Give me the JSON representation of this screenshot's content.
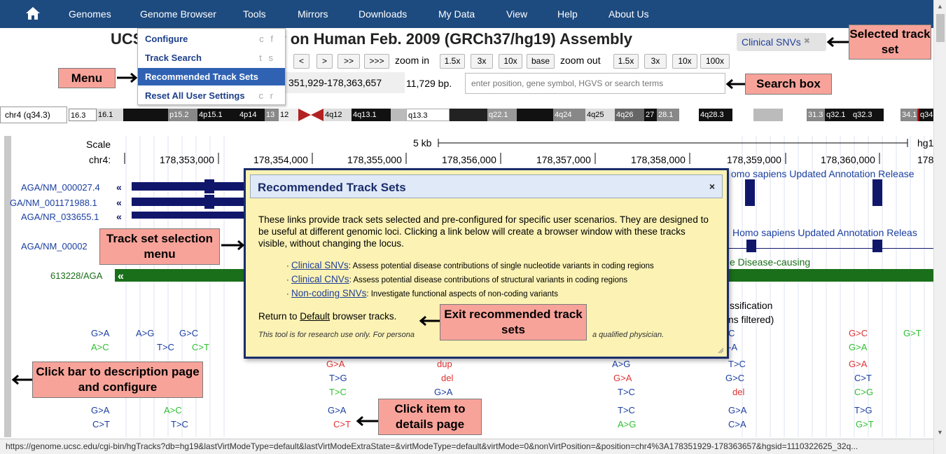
{
  "nav": {
    "items": [
      "Genomes",
      "Genome Browser",
      "Tools",
      "Mirrors",
      "Downloads",
      "My Data",
      "View",
      "Help",
      "About Us"
    ]
  },
  "menu": {
    "items": [
      {
        "label": "Configure",
        "shortcut": "c f"
      },
      {
        "label": "Track Search",
        "shortcut": "t s"
      },
      {
        "label": "Recommended Track Sets",
        "shortcut": ""
      },
      {
        "label": "Reset All User Settings",
        "shortcut": "c r"
      }
    ]
  },
  "title": "UCSC Genome Browser on Human Feb. 2009 (GRCh37/hg19) Assembly",
  "trackset_badge": {
    "label": "Clinical SNVs",
    "close": "✖"
  },
  "controls": {
    "move_buttons": [
      "<",
      ">",
      ">>",
      ">>>"
    ],
    "zoom_in_label": "zoom in",
    "zoom_in_buttons": [
      "1.5x",
      "3x",
      "10x",
      "base"
    ],
    "zoom_out_label": "zoom out",
    "zoom_out_buttons": [
      "1.5x",
      "3x",
      "10x",
      "100x"
    ]
  },
  "position": {
    "value": "351,929-178,363,657",
    "size": "11,729 bp.",
    "search_placeholder": "enter position, gene symbol, HGVS or search terms"
  },
  "ideogram": {
    "chrom": "chr4 (q34.3)",
    "bands": [
      "16.3",
      "16.1",
      "p15.2",
      "4p15.1",
      "4p14",
      "13",
      "12",
      "4q12",
      "4q13.1",
      "q13.3",
      "q22.1",
      "4q24",
      "4q25",
      "4q26",
      "27",
      "28.1",
      "4q28.3",
      "31.3",
      "q32.1",
      "q32.3",
      "34.1",
      "q34"
    ]
  },
  "ruler": {
    "scale_label": "Scale",
    "chrom_label": "chr4:",
    "scale_value": "5 kb",
    "assembly": "hg1",
    "ticks": [
      "178,353,000",
      "178,354,000",
      "178,355,000",
      "178,356,000",
      "178,357,000",
      "178,358,000",
      "178,359,000",
      "178,360,000",
      "178"
    ]
  },
  "tracks": {
    "gene_labels": [
      "AGA/NM_000027.4",
      "GA/NM_001171988.1",
      "AGA/NR_033655.1",
      "AGA/NM_00002"
    ],
    "refseq_title": "omo sapiens Updated Annotation Release",
    "refseq_title2": "Homo sapiens Updated Annotation Releas",
    "omim_label": "613228/AGA",
    "omim_text": "e Disease-causing",
    "classification": "ssification",
    "filtered": "ms filtered)"
  },
  "modal": {
    "title": "Recommended Track Sets",
    "close": "×",
    "intro": "These links provide track sets selected and pre-configured for specific user scenarios. They are designed to be useful at different genomic loci. Clicking a link below will create a browser window with these tracks visible, without changing the locus.",
    "options": [
      {
        "link": "Clinical SNVs",
        "desc": ": Assess potential disease contributions of single nucleotide variants in coding regions"
      },
      {
        "link": "Clinical CNVs",
        "desc": ": Assess potential disease contributions of structural variants in coding regions"
      },
      {
        "link": "Non-coding SNVs",
        "desc": ": Investigate functional aspects of non-coding variants"
      }
    ],
    "return_prefix": "Return to ",
    "return_link": "Default",
    "return_suffix": " browser tracks.",
    "disclaimer_start": "This tool is for research use only. For persona",
    "disclaimer_end": "a qualified physician."
  },
  "callouts": {
    "selected_track_set": "Selected track set",
    "menu": "Menu",
    "search_box": "Search box",
    "track_set_menu": "Track set selection menu",
    "exit": "Exit recommended track sets",
    "click_bar": "Click bar to description page and configure",
    "click_item": "Click item to details page"
  },
  "status_url": "https://genome.ucsc.edu/cgi-bin/hgTracks?db=hg19&lastVirtModeType=default&lastVirtModeExtraState=&virtModeType=default&virtMode=0&nonVirtPosition=&position=chr4%3A178351929-178363657&hgsid=1110322625_32q...",
  "colors": {
    "nav_bg": "#1d4a7f",
    "callout_bg": "#f8a39a",
    "modal_bg": "#fbf2b4",
    "gene": "#1b3fa0",
    "omim": "#1a6f1a"
  }
}
